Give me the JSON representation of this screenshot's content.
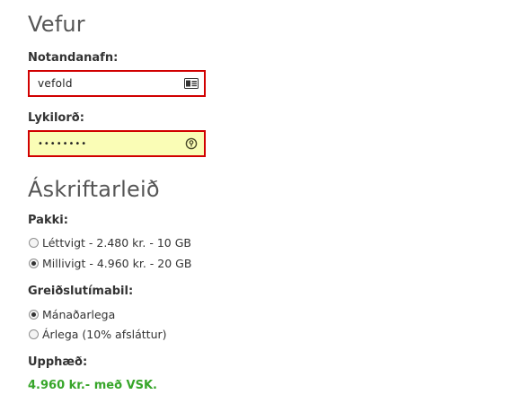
{
  "account": {
    "title": "Vefur",
    "username": {
      "label": "Notandanafn:",
      "value": "vefold",
      "icon": "contact-card-icon"
    },
    "password": {
      "label": "Lykilorð:",
      "value": "••••••••",
      "icon": "password-key-icon"
    }
  },
  "subscription": {
    "title": "Áskriftarleið",
    "package": {
      "label": "Pakki:",
      "options": [
        {
          "label": "Léttvigt - 2.480 kr. - 10 GB",
          "checked": false
        },
        {
          "label": "Millivigt - 4.960 kr. - 20 GB",
          "checked": true
        }
      ]
    },
    "billing": {
      "label": "Greiðslutímabil:",
      "options": [
        {
          "label": "Mánaðarlega",
          "checked": true
        },
        {
          "label": "Árlega (10% afsláttur)",
          "checked": false
        }
      ]
    },
    "amount": {
      "label": "Upphæð:",
      "value": "4.960 kr.- með VSK."
    }
  },
  "colors": {
    "error_border": "#d10000",
    "autofill_background": "#fafdb6",
    "price_green": "#37a62a"
  }
}
